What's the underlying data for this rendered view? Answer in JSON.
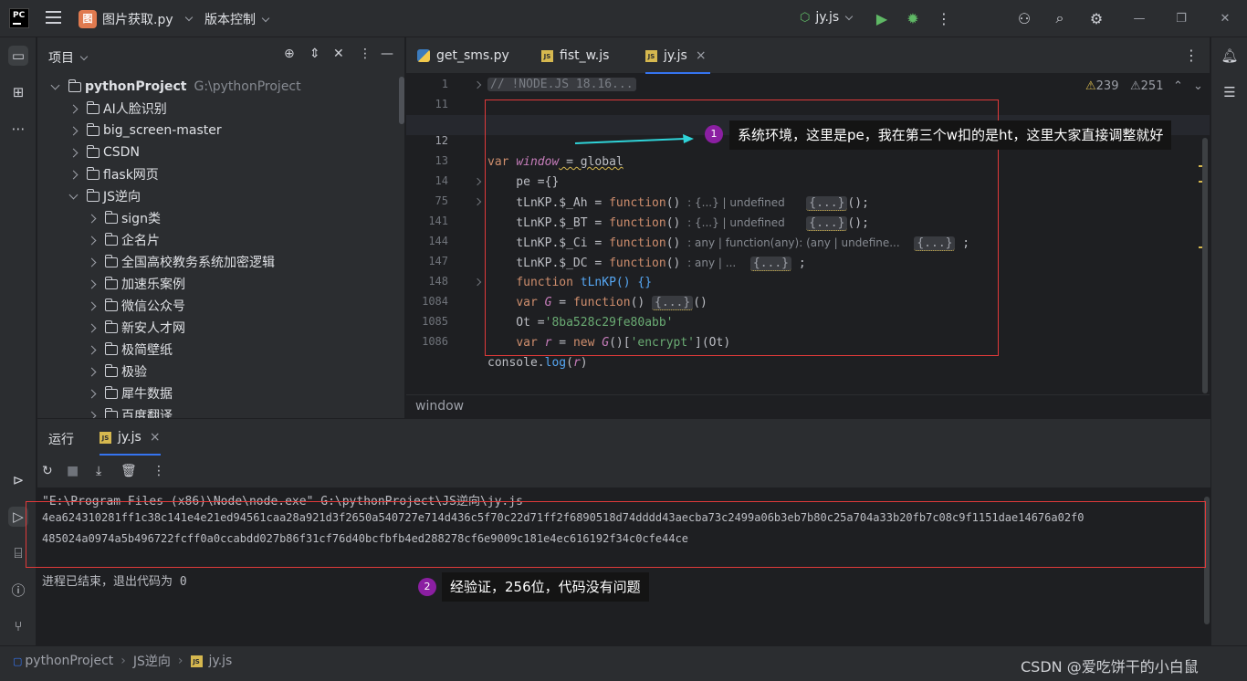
{
  "titlebar": {
    "logo": "PC",
    "project_icon_letter": "图",
    "project_name": "图片获取.py",
    "vcs_label": "版本控制",
    "run_config": "jy.js"
  },
  "project_panel": {
    "title": "项目",
    "tree": [
      {
        "label": "pythonProject",
        "path": "G:\\pythonProject",
        "level": 0,
        "open": true,
        "bold": true
      },
      {
        "label": "AI人脸识别",
        "level": 1,
        "open": false
      },
      {
        "label": "big_screen-master",
        "level": 1,
        "open": false
      },
      {
        "label": "CSDN",
        "level": 1,
        "open": false
      },
      {
        "label": "flask网页",
        "level": 1,
        "open": false
      },
      {
        "label": "JS逆向",
        "level": 1,
        "open": true
      },
      {
        "label": "sign类",
        "level": 2,
        "open": false
      },
      {
        "label": "企名片",
        "level": 2,
        "open": false
      },
      {
        "label": "全国高校教务系统加密逻辑",
        "level": 2,
        "open": false
      },
      {
        "label": "加速乐案例",
        "level": 2,
        "open": false
      },
      {
        "label": "微信公众号",
        "level": 2,
        "open": false
      },
      {
        "label": "新安人才网",
        "level": 2,
        "open": false
      },
      {
        "label": "极简壁纸",
        "level": 2,
        "open": false
      },
      {
        "label": "极验",
        "level": 2,
        "open": false
      },
      {
        "label": "犀牛数据",
        "level": 2,
        "open": false
      },
      {
        "label": "百度翻译",
        "level": 2,
        "open": false
      }
    ]
  },
  "editor": {
    "tabs": [
      {
        "label": "get_sms.py",
        "type": "py",
        "active": false
      },
      {
        "label": "fist_w.js",
        "type": "js",
        "active": false
      },
      {
        "label": "jy.js",
        "type": "js",
        "active": true
      }
    ],
    "warnings": "239",
    "weak_warnings": "251",
    "line_numbers": [
      "1",
      "11",
      "12",
      "13",
      "14",
      "75",
      "141",
      "144",
      "147",
      "148",
      "1084",
      "1085",
      "1086"
    ],
    "lines": {
      "l1": "// !NODE.JS 18.16...",
      "l12_kw": "var",
      "l12_var": "window",
      "l12_rest": " = global",
      "l13": "    pe ={}",
      "l14_a": "    tLnKP.$_Ah = ",
      "l14_fn": "function",
      "l14_b": "()",
      "l14_hint": ": {...} | undefined",
      "l14_fold": "{...}",
      "l14_end": "();",
      "l75_a": "    tLnKP.$_BT = ",
      "l75_hint": ": {...} | undefined",
      "l141_a": "    tLnKP.$_Ci = ",
      "l141_hint": ": any | function(any): (any | undefine...",
      "l141_end": " ;",
      "l144_a": "    tLnKP.$_DC = ",
      "l144_hint": ": any | ...",
      "l147": "tLnKP() {}",
      "l148_var": "G",
      "l148_fold": "{...}",
      "l148_end": "()",
      "l1084_a": "    Ot =",
      "l1084_str": "'8ba528c29fe80abb'",
      "l1085_var": "r",
      "l1085_new": "new",
      "l1085_g": "G",
      "l1085_str": "'encrypt'",
      "l1085_end": "](Ot)",
      "l1086_a": "console.",
      "l1086_fn": "log",
      "l1086_b": "(",
      "l1086_c": ")"
    },
    "breadcrumb": "window"
  },
  "annotations": {
    "a1_badge": "1",
    "a1_text": "系统环境，这里是pe，我在第三个w扣的是ht，这里大家直接调整就好",
    "a2_badge": "2",
    "a2_text": "经验证，256位，代码没有问题"
  },
  "run_panel": {
    "title": "运行",
    "tab": "jy.js",
    "cmd": "\"E:\\Program Files (x86)\\Node\\node.exe\" G:\\pythonProject\\JS逆向\\jy.js",
    "output_line1": "4ea624310281ff1c38c141e4e21ed94561caa28a921d3f2650a540727e714d436c5f70c22d71ff2f6890518d74dddd43aecba73c2499a06b3eb7b80c25a704a33b20fb7c08c9f1151dae14676a02f0",
    "output_line2": "485024a0974a5b496722fcff0a0ccabdd027b86f31cf76d40bcfbfb4ed288278cf6e9009c181e4ec616192f34c0cfe44ce",
    "exit": "进程已结束，退出代码为 0"
  },
  "statusbar": {
    "crumbs": [
      "pythonProject",
      "JS逆向",
      "jy.js"
    ],
    "watermark": "CSDN @爱吃饼干的小白鼠"
  }
}
